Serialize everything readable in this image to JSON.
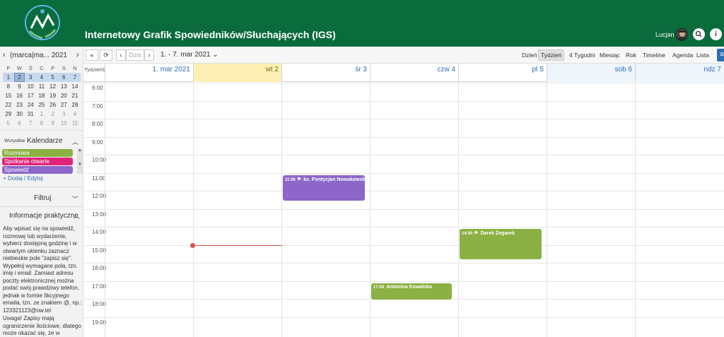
{
  "header": {
    "title": "Internetowy Grafik Spowiedników/Słuchających (IGS)",
    "user": "Lucjan",
    "search_icon": "search-icon",
    "info_icon": "info-icon"
  },
  "sidebar": {
    "mini_title": "(marca|ma... 2021",
    "weekdays": [
      "P",
      "W",
      "Ś",
      "C",
      "P",
      "S",
      "N"
    ],
    "weeks": [
      [
        {
          "d": "1",
          "c": "wk"
        },
        {
          "d": "2",
          "c": "sel"
        },
        {
          "d": "3",
          "c": "wk"
        },
        {
          "d": "4",
          "c": "wk"
        },
        {
          "d": "5",
          "c": "wk"
        },
        {
          "d": "6",
          "c": "wk"
        },
        {
          "d": "7",
          "c": "wk"
        }
      ],
      [
        {
          "d": "8"
        },
        {
          "d": "9"
        },
        {
          "d": "10"
        },
        {
          "d": "11"
        },
        {
          "d": "12"
        },
        {
          "d": "13"
        },
        {
          "d": "14"
        }
      ],
      [
        {
          "d": "15"
        },
        {
          "d": "16"
        },
        {
          "d": "17"
        },
        {
          "d": "18"
        },
        {
          "d": "19"
        },
        {
          "d": "20"
        },
        {
          "d": "21"
        }
      ],
      [
        {
          "d": "22"
        },
        {
          "d": "23"
        },
        {
          "d": "24"
        },
        {
          "d": "25"
        },
        {
          "d": "26"
        },
        {
          "d": "27"
        },
        {
          "d": "28"
        }
      ],
      [
        {
          "d": "29"
        },
        {
          "d": "30"
        },
        {
          "d": "31"
        },
        {
          "d": "1",
          "c": "dim"
        },
        {
          "d": "2",
          "c": "dim"
        },
        {
          "d": "3",
          "c": "dim"
        },
        {
          "d": "4",
          "c": "dim"
        }
      ],
      [
        {
          "d": "5",
          "c": "dim"
        },
        {
          "d": "6",
          "c": "dim"
        },
        {
          "d": "7",
          "c": "dim"
        },
        {
          "d": "8",
          "c": "dim"
        },
        {
          "d": "9",
          "c": "dim"
        },
        {
          "d": "10",
          "c": "dim"
        },
        {
          "d": "11",
          "c": "dim"
        }
      ]
    ],
    "calendars_all": "Wszystkie",
    "calendars_title": "Kalendarze",
    "calendars": [
      {
        "label": "Rozmowa",
        "color": "#8bb043"
      },
      {
        "label": "Spotkanie otwarte",
        "color": "#e0247a"
      },
      {
        "label": "Spowiedź",
        "color": "#8c67c9"
      }
    ],
    "add_edit": "+ Dodaj / Edytuj",
    "filter": "Filtruj",
    "info_title": "Informacje praktyczne",
    "info_text_1": "Aby wpisać się na spowiedź, rozmowę lub wydarzenie, wybierz dostępną godzinę i w otwartym okienku zaznacz niebieskie pole \"zapisz się\". Wypełnij wymagane pola, tzn. imię i email. Zamiast adresu poczty elektronicznej można podać swój prawdziwy telefon, jednak w formie fikcyjnego emaila, tzn. ze znakiem @, np.: 123321123@ow.tel",
    "info_text_2": "Uwaga! Zapisy mają ograniczenie ilościowe, dlatego może okazać się, że w"
  },
  "toolbar": {
    "today": "Dziś",
    "range": "1. - 7. mar 2021",
    "views": [
      "Dzień",
      "Tydzień",
      "4 Tygodni",
      "Miesiąc",
      "Rok",
      "Timeline",
      "Agenda",
      "Lista"
    ],
    "active_view": "Tydzień"
  },
  "grid": {
    "week_label": "Tydzień9",
    "days": [
      {
        "label": "1. mar 2021",
        "kind": "normal"
      },
      {
        "label": "wt 2",
        "kind": "today"
      },
      {
        "label": "śr 3",
        "kind": "normal"
      },
      {
        "label": "czw 4",
        "kind": "normal"
      },
      {
        "label": "pt 5",
        "kind": "normal"
      },
      {
        "label": "sob 6",
        "kind": "wkend"
      },
      {
        "label": "ndz 7",
        "kind": "wkend"
      }
    ],
    "hours": [
      "6:00",
      "7:00",
      "8:00",
      "9:00",
      "10:00",
      "11:00",
      "12:00",
      "13:00",
      "14:00",
      "15:00",
      "16:00",
      "17:00",
      "18:00",
      "19:00"
    ],
    "events": [
      {
        "time": "11:00",
        "title": "ks. Pontycjan Nowakowski",
        "day": 2,
        "start": 11.0,
        "end": 12.5,
        "color": "#8c67c9",
        "flag": true
      },
      {
        "time": "14:00",
        "title": "Darek Żegarek",
        "day": 4,
        "start": 14.0,
        "end": 15.75,
        "color": "#8bb043",
        "flag": true
      },
      {
        "time": "17:00",
        "title": "Antonina Kowalska",
        "day": 3,
        "start": 17.0,
        "end": 18.0,
        "color": "#8bb043",
        "flag": false
      }
    ]
  }
}
